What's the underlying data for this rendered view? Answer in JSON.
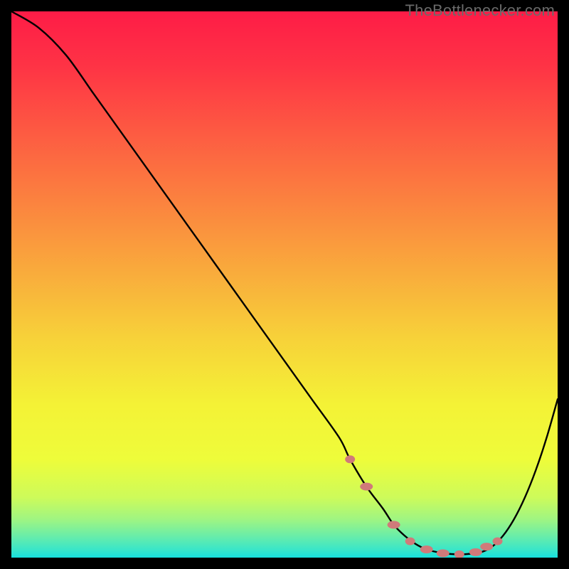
{
  "watermark": "TheBottlenecker.com",
  "chart_data": {
    "type": "line",
    "title": "",
    "xlabel": "",
    "ylabel": "",
    "xlim": [
      0,
      100
    ],
    "ylim": [
      0,
      100
    ],
    "x": [
      0,
      5,
      10,
      15,
      20,
      25,
      30,
      35,
      40,
      45,
      50,
      55,
      60,
      62,
      65,
      68,
      70,
      72,
      74,
      76,
      78,
      80,
      82,
      84,
      86,
      88,
      90,
      92,
      94,
      96,
      98,
      100
    ],
    "y": [
      100,
      97,
      92,
      85,
      78,
      71,
      64,
      57,
      50,
      43,
      36,
      29,
      22,
      18,
      13,
      9,
      6,
      4,
      2.5,
      1.5,
      1,
      0.7,
      0.6,
      0.7,
      1,
      2,
      4,
      7,
      11,
      16,
      22,
      29
    ],
    "marker_points": {
      "x": [
        62,
        65,
        70,
        73,
        76,
        79,
        82,
        85,
        87,
        89
      ],
      "y": [
        18,
        13,
        6,
        3,
        1.5,
        0.8,
        0.6,
        1,
        2,
        3
      ]
    },
    "curve_color": "#000000",
    "marker_color": "#d07a7a",
    "background_gradient": {
      "stops": [
        {
          "offset": 0.0,
          "color": "#fe1c47"
        },
        {
          "offset": 0.1,
          "color": "#fe3345"
        },
        {
          "offset": 0.22,
          "color": "#fd5a42"
        },
        {
          "offset": 0.35,
          "color": "#fb833f"
        },
        {
          "offset": 0.48,
          "color": "#f9ac3c"
        },
        {
          "offset": 0.6,
          "color": "#f7d239"
        },
        {
          "offset": 0.72,
          "color": "#f4f236"
        },
        {
          "offset": 0.82,
          "color": "#eefc3a"
        },
        {
          "offset": 0.89,
          "color": "#cdfb5a"
        },
        {
          "offset": 0.93,
          "color": "#9ff582"
        },
        {
          "offset": 0.96,
          "color": "#6aeda8"
        },
        {
          "offset": 0.985,
          "color": "#3ae6c8"
        },
        {
          "offset": 1.0,
          "color": "#17e0de"
        }
      ]
    }
  }
}
